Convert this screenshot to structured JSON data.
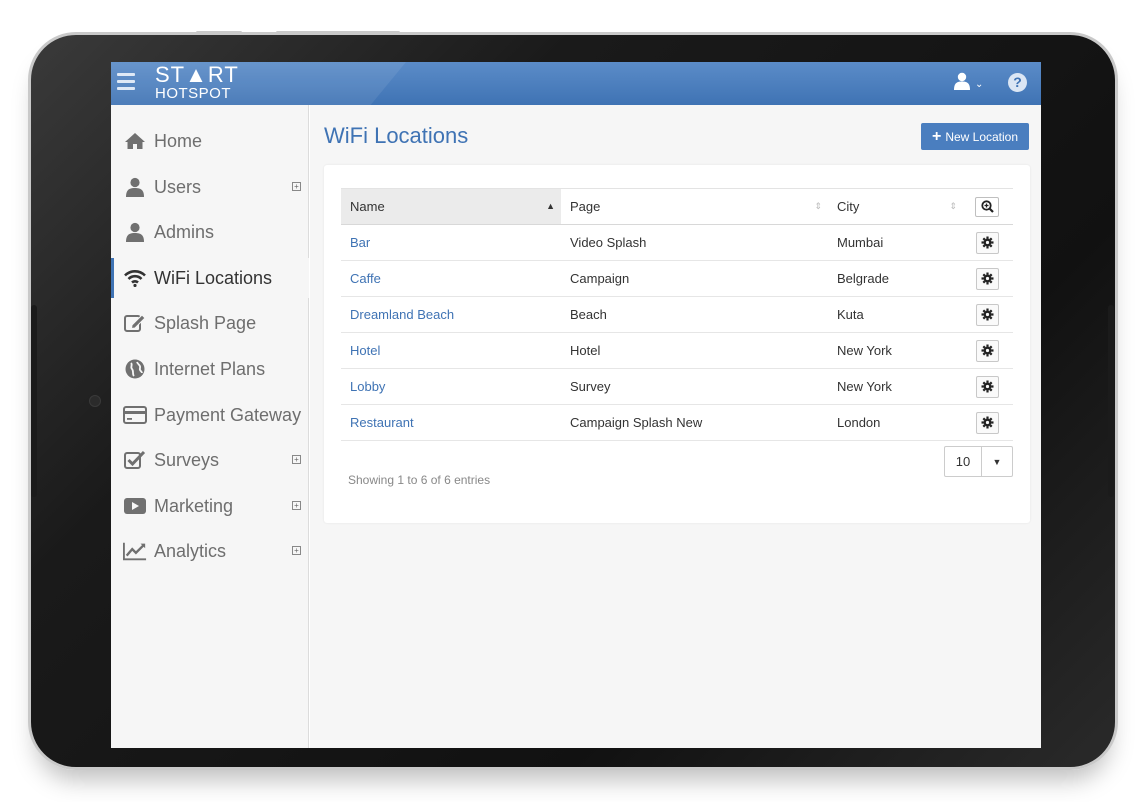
{
  "app": {
    "logo_line1": "ST▲RT",
    "logo_line2": "HOTSPOT"
  },
  "header": {
    "user_icon": "user-icon",
    "help_label": "?"
  },
  "sidebar": {
    "items": [
      {
        "label": "Home",
        "icon": "home-icon"
      },
      {
        "label": "Users",
        "icon": "user-icon",
        "expandable": true
      },
      {
        "label": "Admins",
        "icon": "admin-icon"
      },
      {
        "label": "WiFi Locations",
        "icon": "wifi-icon",
        "active": true
      },
      {
        "label": "Splash Page",
        "icon": "edit-icon"
      },
      {
        "label": "Internet Plans",
        "icon": "globe-icon"
      },
      {
        "label": "Payment Gateway",
        "icon": "credit-card-icon"
      },
      {
        "label": "Surveys",
        "icon": "checkbox-icon",
        "expandable": true
      },
      {
        "label": "Marketing",
        "icon": "play-icon",
        "expandable": true
      },
      {
        "label": "Analytics",
        "icon": "chart-icon",
        "expandable": true
      }
    ]
  },
  "main": {
    "title": "WiFi Locations",
    "new_button_label": "New Location",
    "table": {
      "columns": [
        "Name",
        "Page",
        "City"
      ],
      "rows": [
        {
          "name": "Bar",
          "page": "Video Splash",
          "city": "Mumbai"
        },
        {
          "name": "Caffe",
          "page": "Campaign",
          "city": "Belgrade"
        },
        {
          "name": "Dreamland Beach",
          "page": "Beach",
          "city": "Kuta"
        },
        {
          "name": "Hotel",
          "page": "Hotel",
          "city": "New York"
        },
        {
          "name": "Lobby",
          "page": "Survey",
          "city": "New York"
        },
        {
          "name": "Restaurant",
          "page": "Campaign Splash New",
          "city": "London"
        }
      ]
    },
    "info": "Showing 1 to 6 of 6 entries",
    "page_size": "10"
  },
  "colors": {
    "accent": "#3f73b4",
    "header": "#4a7ebf",
    "sidebar_bg": "#f6f6f6"
  }
}
